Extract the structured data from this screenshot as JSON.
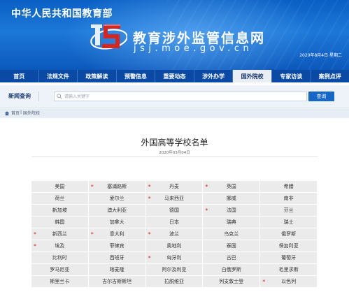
{
  "header": {
    "ministry": "中华人民共和国教育部",
    "site_title": "教育涉外监管信息网",
    "site_domain": "jsj.moe.gov.cn",
    "date": "2020年8月4日 星期二"
  },
  "nav": {
    "items": [
      {
        "label": "首页",
        "active": false
      },
      {
        "label": "法规文件",
        "active": false
      },
      {
        "label": "政策解读",
        "active": false
      },
      {
        "label": "预警信息",
        "active": false
      },
      {
        "label": "重要动态",
        "active": false
      },
      {
        "label": "涉外办学",
        "active": false
      },
      {
        "label": "国外院校",
        "active": true
      },
      {
        "label": "专家访谈",
        "active": false
      },
      {
        "label": "案例点评",
        "active": false
      }
    ]
  },
  "search": {
    "label": "新闻查询",
    "placeholder": "请输入关键字",
    "button": "查询"
  },
  "breadcrumb": {
    "home": "首页",
    "separator": "|",
    "current": "国外院校"
  },
  "article": {
    "title": "外国高等学校名单",
    "date": "2020年03月04日"
  },
  "countries": [
    {
      "name": "美国",
      "star": false
    },
    {
      "name": "塞浦路斯",
      "star": true
    },
    {
      "name": "丹麦",
      "star": true
    },
    {
      "name": "英国",
      "star": true
    },
    {
      "name": "希腊",
      "star": false
    },
    {
      "name": "荷兰",
      "star": false
    },
    {
      "name": "爱尔兰",
      "star": false
    },
    {
      "name": "马来西亚",
      "star": true
    },
    {
      "name": "挪威",
      "star": false
    },
    {
      "name": "南非",
      "star": false
    },
    {
      "name": "新加坡",
      "star": false
    },
    {
      "name": "澳大利亚",
      "star": false
    },
    {
      "name": "德国",
      "star": false
    },
    {
      "name": "法国",
      "star": true
    },
    {
      "name": "芬兰",
      "star": false
    },
    {
      "name": "韩国",
      "star": false
    },
    {
      "name": "加拿大",
      "star": false
    },
    {
      "name": "日本",
      "star": false
    },
    {
      "name": "瑞典",
      "star": false
    },
    {
      "name": "瑞士",
      "star": false
    },
    {
      "name": "新西兰",
      "star": true
    },
    {
      "name": "意大利",
      "star": true
    },
    {
      "name": "波兰",
      "star": true
    },
    {
      "name": "乌克兰",
      "star": false
    },
    {
      "name": "俄罗斯",
      "star": false
    },
    {
      "name": "埃及",
      "star": true
    },
    {
      "name": "菲律宾",
      "star": false
    },
    {
      "name": "奥地利",
      "star": false
    },
    {
      "name": "泰国",
      "star": false
    },
    {
      "name": "保加利亚",
      "star": false
    },
    {
      "name": "比利时",
      "star": false
    },
    {
      "name": "西班牙",
      "star": false
    },
    {
      "name": "匈牙利",
      "star": true
    },
    {
      "name": "古巴",
      "star": false
    },
    {
      "name": "葡萄牙",
      "star": false
    },
    {
      "name": "罗马尼亚",
      "star": false
    },
    {
      "name": "喀麦隆",
      "star": false
    },
    {
      "name": "阿尔及利亚",
      "star": false
    },
    {
      "name": "白俄罗斯",
      "star": false
    },
    {
      "name": "毛里求斯",
      "star": false
    },
    {
      "name": "斯里兰卡",
      "star": false
    },
    {
      "name": "吉尔吉斯斯坦",
      "star": false
    },
    {
      "name": "拉脱维亚",
      "star": false
    },
    {
      "name": "列支敦士登",
      "star": false
    },
    {
      "name": "以色列",
      "star": true
    }
  ],
  "colors": {
    "banner_blue": "#1567c8",
    "nav_blue": "#0a4aa5",
    "star_red": "#d61f1f",
    "cell_gray": "#ebebeb"
  }
}
